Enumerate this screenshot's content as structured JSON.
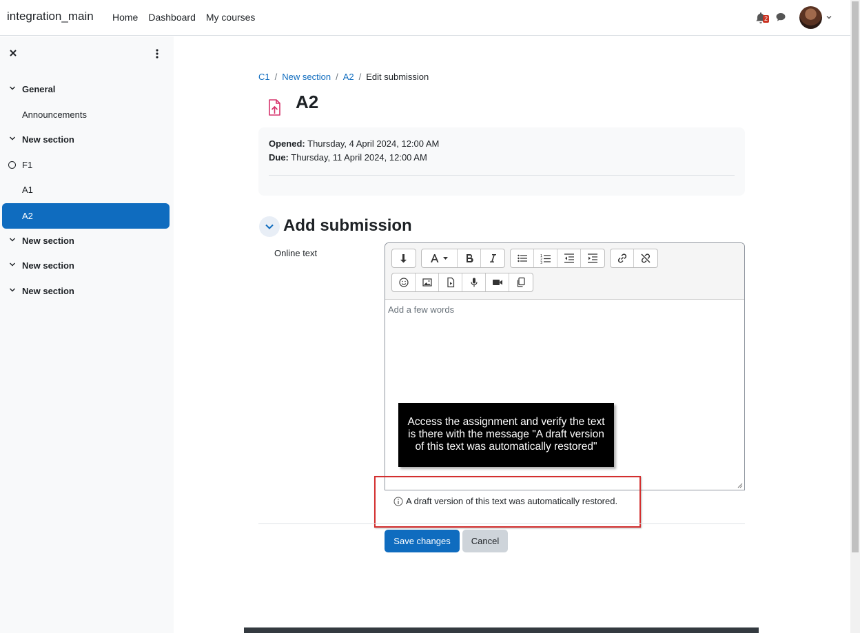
{
  "header": {
    "site_name": "integration_main",
    "nav": [
      "Home",
      "Dashboard",
      "My courses"
    ],
    "notification_count": "2"
  },
  "course_index": {
    "items": [
      {
        "label": "General",
        "type": "section"
      },
      {
        "label": "Announcements",
        "type": "activity"
      },
      {
        "label": "New section",
        "type": "section"
      },
      {
        "label": "F1",
        "type": "activity-incomplete"
      },
      {
        "label": "A1",
        "type": "activity"
      },
      {
        "label": "A2",
        "type": "activity-active"
      },
      {
        "label": "New section",
        "type": "section"
      },
      {
        "label": "New section",
        "type": "section"
      },
      {
        "label": "New section",
        "type": "section"
      }
    ]
  },
  "breadcrumb": {
    "items": [
      "C1",
      "New section",
      "A2"
    ],
    "current": "Edit submission"
  },
  "activity": {
    "title": "A2",
    "opened_label": "Opened:",
    "opened_value": "Thursday, 4 April 2024, 12:00 AM",
    "due_label": "Due:",
    "due_value": "Thursday, 11 April 2024, 12:00 AM"
  },
  "submission": {
    "section_title": "Add submission",
    "field_label": "Online text",
    "placeholder": "Add a few words",
    "draft_message": "A draft version of this text was automatically restored.",
    "save_label": "Save changes",
    "cancel_label": "Cancel"
  },
  "annotation": {
    "text": "Access the assignment and verify the text is there with the message \"A draft version of this text was automatically restored\""
  },
  "toolbar_icons": {
    "row1": [
      [
        "collapse-icon"
      ],
      [
        "font-style-icon",
        "bold-icon",
        "italic-icon"
      ],
      [
        "unordered-list-icon",
        "ordered-list-icon",
        "outdent-icon",
        "indent-icon"
      ],
      [
        "link-icon",
        "unlink-icon"
      ]
    ],
    "row2": [
      [
        "emoji-icon",
        "image-icon",
        "media-file-icon",
        "record-audio-icon",
        "record-video-icon",
        "manage-files-icon"
      ]
    ]
  },
  "colors": {
    "primary": "#0f6cbf",
    "annotation_border": "#d32f2f",
    "badge": "#ca3120"
  }
}
